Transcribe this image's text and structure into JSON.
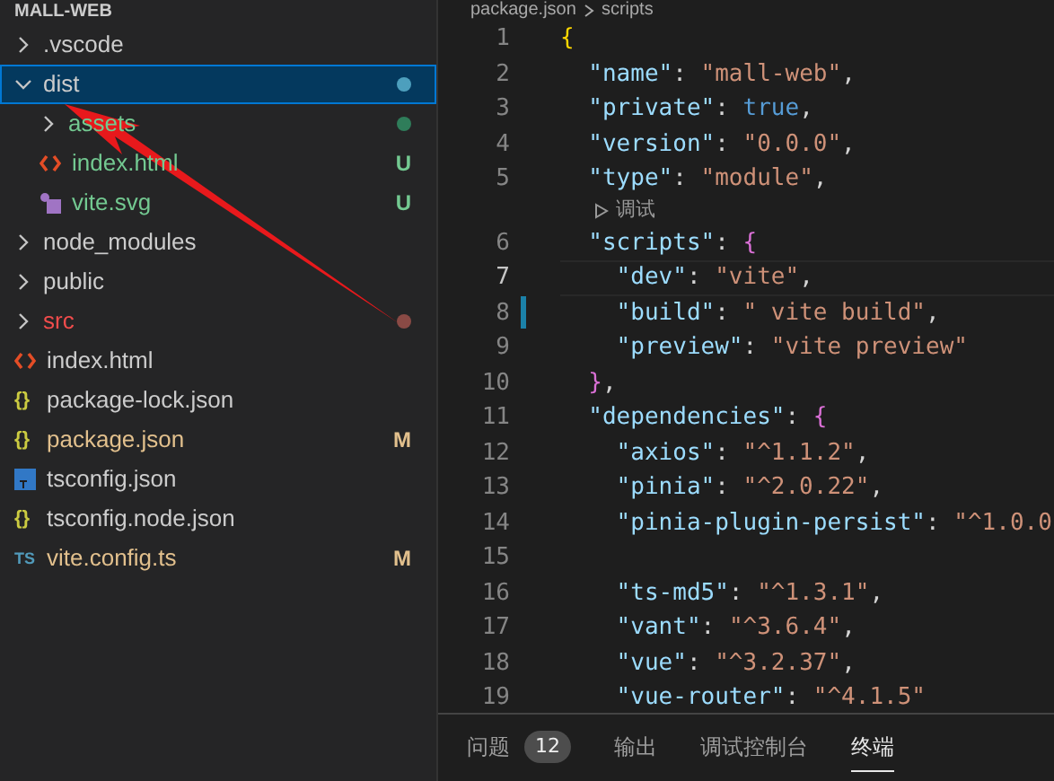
{
  "explorer": {
    "title": "MALL-WEB",
    "items": [
      {
        "label": ".vscode",
        "kind": "folder",
        "expanded": false,
        "selected": false
      },
      {
        "label": "dist",
        "kind": "folder",
        "expanded": true,
        "selected": true,
        "dot": {
          "color": "#4d9fbd"
        },
        "children": [
          {
            "label": "assets",
            "kind": "folder",
            "expanded": false,
            "selected": false,
            "color": "#73c991",
            "dot": {
              "color": "#2f7d5a"
            }
          },
          {
            "label": "index.html",
            "kind": "html",
            "selected": false,
            "color": "#73c991",
            "badge": "U"
          },
          {
            "label": "vite.svg",
            "kind": "svg",
            "selected": false,
            "color": "#73c991",
            "badge": "U"
          }
        ]
      },
      {
        "label": "node_modules",
        "kind": "folder",
        "expanded": false,
        "selected": false
      },
      {
        "label": "public",
        "kind": "folder",
        "expanded": false,
        "selected": false
      },
      {
        "label": "src",
        "kind": "folder",
        "expanded": false,
        "selected": false,
        "color": "#f14c4c",
        "dot": {
          "color": "#8a4a45"
        }
      },
      {
        "label": "index.html",
        "kind": "html",
        "selected": false
      },
      {
        "label": "package-lock.json",
        "kind": "json",
        "icon": "{}",
        "selected": false
      },
      {
        "label": "package.json",
        "kind": "json",
        "icon": "{}",
        "selected": false,
        "color": "#e2c08d",
        "badge": "M"
      },
      {
        "label": "tsconfig.json",
        "kind": "tsconfig",
        "selected": false
      },
      {
        "label": "tsconfig.node.json",
        "kind": "json",
        "icon": "{}",
        "selected": false
      },
      {
        "label": "vite.config.ts",
        "kind": "ts",
        "icon": "TS",
        "selected": false,
        "color": "#e2c08d",
        "badge": "M"
      }
    ]
  },
  "breadcrumb": [
    "package.json",
    "scripts"
  ],
  "lines": [
    {
      "kind": "code",
      "number": "1",
      "tokens": [
        {
          "kind": "brace",
          "text": "{"
        }
      ]
    },
    {
      "kind": "code",
      "number": "2",
      "tokens": [
        {
          "kind": "key",
          "text": "  \"name\""
        },
        {
          "kind": "punct",
          "text": ": "
        },
        {
          "kind": "string",
          "text": "\"mall-web\""
        },
        {
          "kind": "punct",
          "text": ","
        }
      ]
    },
    {
      "kind": "code",
      "number": "3",
      "tokens": [
        {
          "kind": "key",
          "text": "  \"private\""
        },
        {
          "kind": "punct",
          "text": ": "
        },
        {
          "kind": "keyword",
          "text": "true"
        },
        {
          "kind": "punct",
          "text": ","
        }
      ]
    },
    {
      "kind": "code",
      "number": "4",
      "tokens": [
        {
          "kind": "key",
          "text": "  \"version\""
        },
        {
          "kind": "punct",
          "text": ": "
        },
        {
          "kind": "string",
          "text": "\"0.0.0\""
        },
        {
          "kind": "punct",
          "text": ","
        }
      ]
    },
    {
      "kind": "code",
      "number": "5",
      "tokens": [
        {
          "kind": "key",
          "text": "  \"type\""
        },
        {
          "kind": "punct",
          "text": ": "
        },
        {
          "kind": "string",
          "text": "\"module\""
        },
        {
          "kind": "punct",
          "text": ","
        }
      ]
    },
    {
      "kind": "codelens",
      "text": "调试"
    },
    {
      "kind": "code",
      "number": "6",
      "tokens": [
        {
          "kind": "key",
          "text": "  \"scripts\""
        },
        {
          "kind": "punct",
          "text": ": "
        },
        {
          "kind": "brace2",
          "text": "{"
        }
      ]
    },
    {
      "kind": "code",
      "number": "7",
      "current": true,
      "tokens": [
        {
          "kind": "key",
          "text": "    \"dev\""
        },
        {
          "kind": "punct",
          "text": ": "
        },
        {
          "kind": "string",
          "text": "\"vite\""
        },
        {
          "kind": "punct",
          "text": ","
        }
      ]
    },
    {
      "kind": "code",
      "number": "8",
      "modified": true,
      "tokens": [
        {
          "kind": "key",
          "text": "    \"build\""
        },
        {
          "kind": "punct",
          "text": ": "
        },
        {
          "kind": "string",
          "text": "\" vite build\""
        },
        {
          "kind": "punct",
          "text": ","
        }
      ]
    },
    {
      "kind": "code",
      "number": "9",
      "tokens": [
        {
          "kind": "key",
          "text": "    \"preview\""
        },
        {
          "kind": "punct",
          "text": ": "
        },
        {
          "kind": "string",
          "text": "\"vite preview\""
        }
      ]
    },
    {
      "kind": "code",
      "number": "10",
      "tokens": [
        {
          "kind": "brace2",
          "text": "  }"
        },
        {
          "kind": "punct",
          "text": ","
        }
      ]
    },
    {
      "kind": "code",
      "number": "11",
      "tokens": [
        {
          "kind": "key",
          "text": "  \"dependencies\""
        },
        {
          "kind": "punct",
          "text": ": "
        },
        {
          "kind": "brace2",
          "text": "{"
        }
      ]
    },
    {
      "kind": "code",
      "number": "12",
      "tokens": [
        {
          "kind": "key",
          "text": "    \"axios\""
        },
        {
          "kind": "punct",
          "text": ": "
        },
        {
          "kind": "string",
          "text": "\"^1.1.2\""
        },
        {
          "kind": "punct",
          "text": ","
        }
      ]
    },
    {
      "kind": "code",
      "number": "13",
      "tokens": [
        {
          "kind": "key",
          "text": "    \"pinia\""
        },
        {
          "kind": "punct",
          "text": ": "
        },
        {
          "kind": "string",
          "text": "\"^2.0.22\""
        },
        {
          "kind": "punct",
          "text": ","
        }
      ]
    },
    {
      "kind": "code",
      "number": "14",
      "tokens": [
        {
          "kind": "key",
          "text": "    \"pinia-plugin-persist\""
        },
        {
          "kind": "punct",
          "text": ": "
        },
        {
          "kind": "string",
          "text": "\"^1.0.0"
        }
      ]
    },
    {
      "kind": "code",
      "number": "15"
    },
    {
      "kind": "code",
      "number": "16",
      "tokens": [
        {
          "kind": "key",
          "text": "    \"ts-md5\""
        },
        {
          "kind": "punct",
          "text": ": "
        },
        {
          "kind": "string",
          "text": "\"^1.3.1\""
        },
        {
          "kind": "punct",
          "text": ","
        }
      ]
    },
    {
      "kind": "code",
      "number": "17",
      "tokens": [
        {
          "kind": "key",
          "text": "    \"vant\""
        },
        {
          "kind": "punct",
          "text": ": "
        },
        {
          "kind": "string",
          "text": "\"^3.6.4\""
        },
        {
          "kind": "punct",
          "text": ","
        }
      ]
    },
    {
      "kind": "code",
      "number": "18",
      "tokens": [
        {
          "kind": "key",
          "text": "    \"vue\""
        },
        {
          "kind": "punct",
          "text": ": "
        },
        {
          "kind": "string",
          "text": "\"^3.2.37\""
        },
        {
          "kind": "punct",
          "text": ","
        }
      ]
    },
    {
      "kind": "code",
      "number": "19",
      "tokens": [
        {
          "kind": "key",
          "text": "    \"vue-router\""
        },
        {
          "kind": "punct",
          "text": ": "
        },
        {
          "kind": "string",
          "text": "\"^4.1.5\""
        }
      ]
    }
  ],
  "panel_tabs": [
    {
      "label": "问题",
      "count": "12",
      "selected": false
    },
    {
      "label": "输出",
      "selected": false
    },
    {
      "label": "调试控制台",
      "selected": false
    },
    {
      "label": "终端",
      "selected": true
    }
  ]
}
